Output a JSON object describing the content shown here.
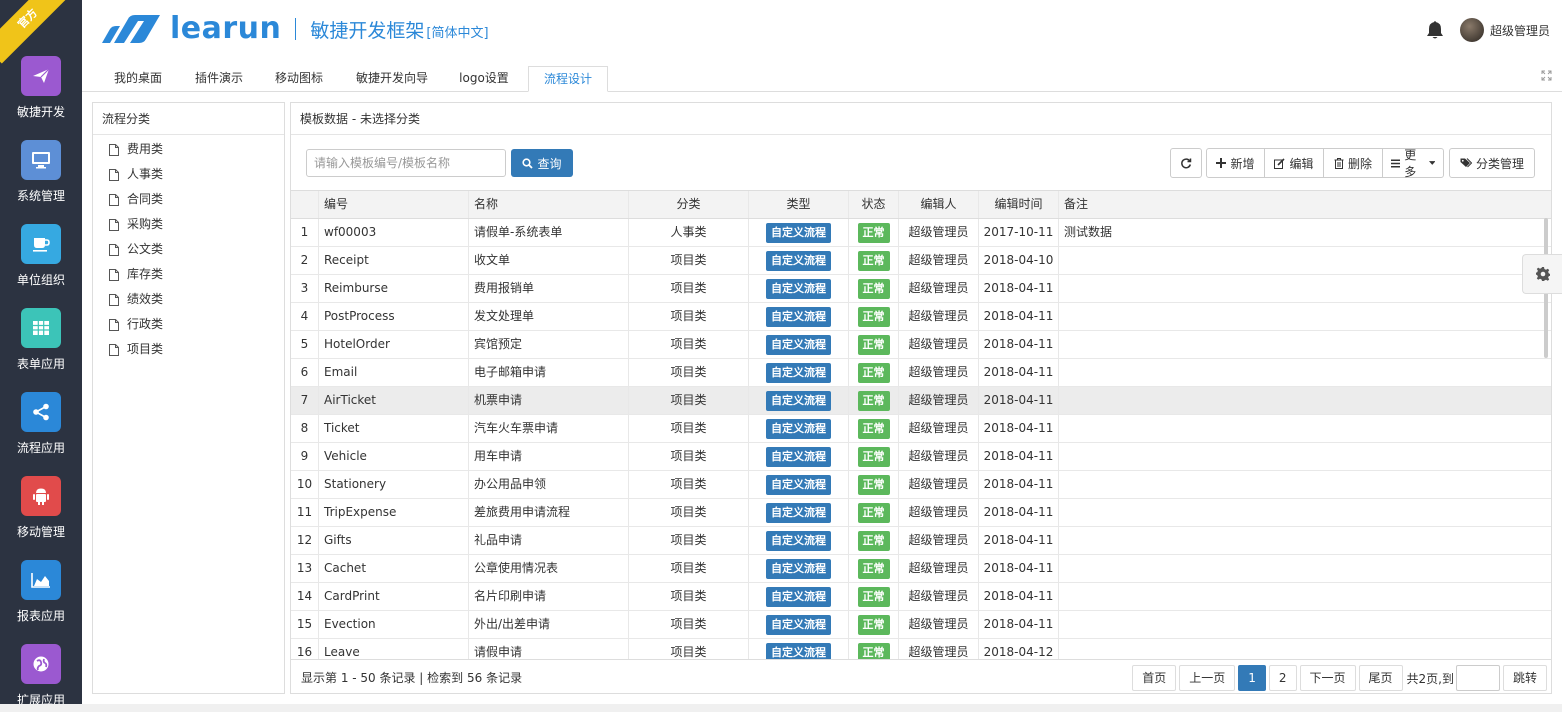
{
  "ribbon": "官方",
  "sidebar": {
    "items": [
      {
        "label": "敏捷开发",
        "icon": "paper-plane-icon",
        "color": "#9b59d0"
      },
      {
        "label": "系统管理",
        "icon": "desktop-icon",
        "color": "#5d8fd6"
      },
      {
        "label": "单位组织",
        "icon": "coffee-icon",
        "color": "#36a9e1"
      },
      {
        "label": "表单应用",
        "icon": "table-icon",
        "color": "#3cc4b8"
      },
      {
        "label": "流程应用",
        "icon": "share-icon",
        "color": "#2b88d8"
      },
      {
        "label": "移动管理",
        "icon": "android-icon",
        "color": "#e14b4b"
      },
      {
        "label": "报表应用",
        "icon": "area-chart-icon",
        "color": "#2b88d8"
      },
      {
        "label": "扩展应用",
        "icon": "globe-icon",
        "color": "#9b59d0"
      }
    ]
  },
  "header": {
    "logo_text": "learun",
    "subtitle": "敏捷开发框架",
    "lang": "[简体中文]",
    "user_name": "超级管理员"
  },
  "tabs": [
    {
      "label": "我的桌面",
      "active": false
    },
    {
      "label": "插件演示",
      "active": false
    },
    {
      "label": "移动图标",
      "active": false
    },
    {
      "label": "敏捷开发向导",
      "active": false
    },
    {
      "label": "logo设置",
      "active": false
    },
    {
      "label": "流程设计",
      "active": true
    }
  ],
  "tree": {
    "title": "流程分类",
    "items": [
      "费用类",
      "人事类",
      "合同类",
      "采购类",
      "公文类",
      "库存类",
      "绩效类",
      "行政类",
      "项目类"
    ]
  },
  "main": {
    "title": "模板数据 - 未选择分类",
    "search_placeholder": "请输入模板编号/模板名称",
    "search_button": "查询",
    "toolbar": {
      "add": "新增",
      "edit": "编辑",
      "delete": "删除",
      "more": "更多",
      "category": "分类管理"
    }
  },
  "grid": {
    "columns": [
      "",
      "编号",
      "名称",
      "分类",
      "类型",
      "状态",
      "编辑人",
      "编辑时间",
      "备注"
    ],
    "rows": [
      {
        "n": "1",
        "code": "wf00003",
        "name": "请假单-系统表单",
        "cat": "人事类",
        "type": "自定义流程",
        "status": "正常",
        "editor": "超级管理员",
        "date": "2017-10-11",
        "note": "测试数据"
      },
      {
        "n": "2",
        "code": "Receipt",
        "name": "收文单",
        "cat": "项目类",
        "type": "自定义流程",
        "status": "正常",
        "editor": "超级管理员",
        "date": "2018-04-10",
        "note": ""
      },
      {
        "n": "3",
        "code": "Reimburse",
        "name": "费用报销单",
        "cat": "项目类",
        "type": "自定义流程",
        "status": "正常",
        "editor": "超级管理员",
        "date": "2018-04-11",
        "note": ""
      },
      {
        "n": "4",
        "code": "PostProcess",
        "name": "发文处理单",
        "cat": "项目类",
        "type": "自定义流程",
        "status": "正常",
        "editor": "超级管理员",
        "date": "2018-04-11",
        "note": ""
      },
      {
        "n": "5",
        "code": "HotelOrder",
        "name": "宾馆预定",
        "cat": "项目类",
        "type": "自定义流程",
        "status": "正常",
        "editor": "超级管理员",
        "date": "2018-04-11",
        "note": ""
      },
      {
        "n": "6",
        "code": "Email",
        "name": "电子邮箱申请",
        "cat": "项目类",
        "type": "自定义流程",
        "status": "正常",
        "editor": "超级管理员",
        "date": "2018-04-11",
        "note": ""
      },
      {
        "n": "7",
        "code": "AirTicket",
        "name": "机票申请",
        "cat": "项目类",
        "type": "自定义流程",
        "status": "正常",
        "editor": "超级管理员",
        "date": "2018-04-11",
        "note": ""
      },
      {
        "n": "8",
        "code": "Ticket",
        "name": "汽车火车票申请",
        "cat": "项目类",
        "type": "自定义流程",
        "status": "正常",
        "editor": "超级管理员",
        "date": "2018-04-11",
        "note": ""
      },
      {
        "n": "9",
        "code": "Vehicle",
        "name": "用车申请",
        "cat": "项目类",
        "type": "自定义流程",
        "status": "正常",
        "editor": "超级管理员",
        "date": "2018-04-11",
        "note": ""
      },
      {
        "n": "10",
        "code": "Stationery",
        "name": "办公用品申领",
        "cat": "项目类",
        "type": "自定义流程",
        "status": "正常",
        "editor": "超级管理员",
        "date": "2018-04-11",
        "note": ""
      },
      {
        "n": "11",
        "code": "TripExpense",
        "name": "差旅费用申请流程",
        "cat": "项目类",
        "type": "自定义流程",
        "status": "正常",
        "editor": "超级管理员",
        "date": "2018-04-11",
        "note": ""
      },
      {
        "n": "12",
        "code": "Gifts",
        "name": "礼品申请",
        "cat": "项目类",
        "type": "自定义流程",
        "status": "正常",
        "editor": "超级管理员",
        "date": "2018-04-11",
        "note": ""
      },
      {
        "n": "13",
        "code": "Cachet",
        "name": "公章使用情况表",
        "cat": "项目类",
        "type": "自定义流程",
        "status": "正常",
        "editor": "超级管理员",
        "date": "2018-04-11",
        "note": ""
      },
      {
        "n": "14",
        "code": "CardPrint",
        "name": "名片印刷申请",
        "cat": "项目类",
        "type": "自定义流程",
        "status": "正常",
        "editor": "超级管理员",
        "date": "2018-04-11",
        "note": ""
      },
      {
        "n": "15",
        "code": "Evection",
        "name": "外出/出差申请",
        "cat": "项目类",
        "type": "自定义流程",
        "status": "正常",
        "editor": "超级管理员",
        "date": "2018-04-11",
        "note": ""
      },
      {
        "n": "16",
        "code": "Leave",
        "name": "请假申请",
        "cat": "项目类",
        "type": "自定义流程",
        "status": "正常",
        "editor": "超级管理员",
        "date": "2018-04-12",
        "note": ""
      }
    ]
  },
  "footer": {
    "info": "显示第 1 - 50 条记录 | 检索到 56 条记录",
    "first": "首页",
    "prev": "上一页",
    "page1": "1",
    "page2": "2",
    "next": "下一页",
    "last": "尾页",
    "total": "共2页,到",
    "go": "跳转"
  }
}
